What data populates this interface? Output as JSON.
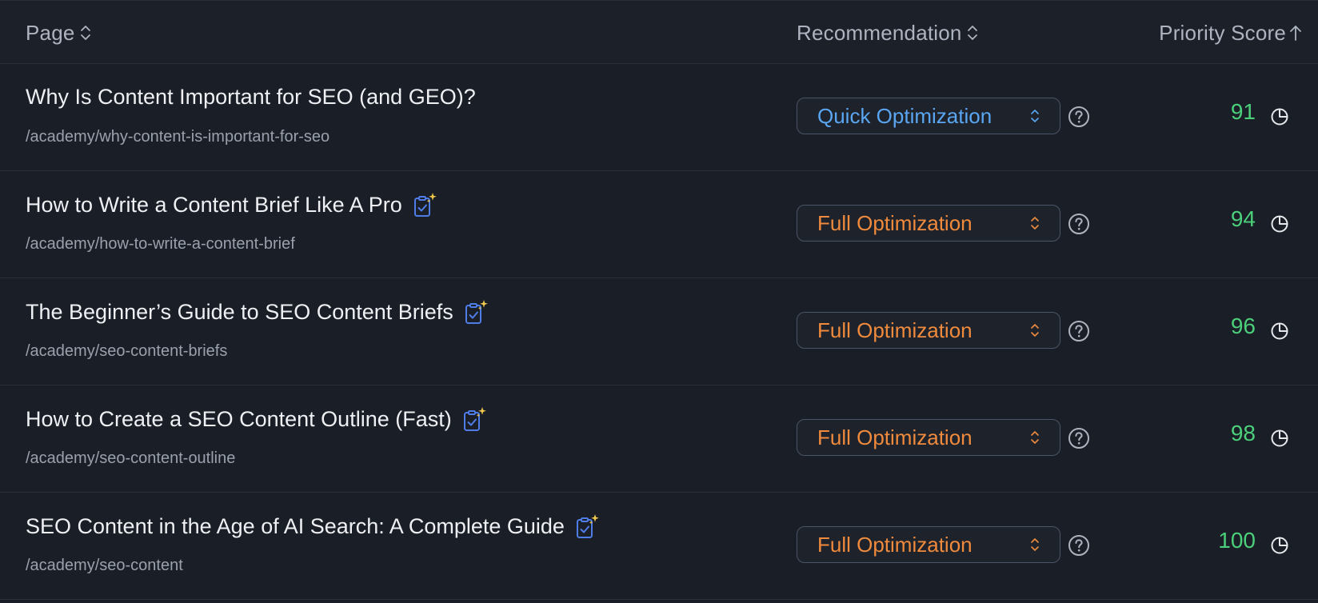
{
  "header": {
    "page_label": "Page",
    "recommendation_label": "Recommendation",
    "score_label": "Priority Score"
  },
  "colors": {
    "quick": "#5aa6f2",
    "full": "#f08a3c",
    "score": "#4ccf7a",
    "brief_icon": "#4f7de8",
    "sparkle": "#f2c94c"
  },
  "rows": [
    {
      "title": "Why Is Content Important for SEO (and GEO)?",
      "url": "/academy/why-content-is-important-for-seo",
      "has_brief_icon": false,
      "recommendation": "Quick Optimization",
      "rec_type": "quick",
      "score": "91"
    },
    {
      "title": "How to Write a Content Brief Like A Pro",
      "url": "/academy/how-to-write-a-content-brief",
      "has_brief_icon": true,
      "recommendation": "Full Optimization",
      "rec_type": "full",
      "score": "94"
    },
    {
      "title": "The Beginner’s Guide to SEO Content Briefs",
      "url": "/academy/seo-content-briefs",
      "has_brief_icon": true,
      "recommendation": "Full Optimization",
      "rec_type": "full",
      "score": "96"
    },
    {
      "title": "How to Create a SEO Content Outline (Fast)",
      "url": "/academy/seo-content-outline",
      "has_brief_icon": true,
      "recommendation": "Full Optimization",
      "rec_type": "full",
      "score": "98"
    },
    {
      "title": "SEO Content in the Age of AI Search: A Complete Guide",
      "url": "/academy/seo-content",
      "has_brief_icon": true,
      "recommendation": "Full Optimization",
      "rec_type": "full",
      "score": "100"
    }
  ]
}
